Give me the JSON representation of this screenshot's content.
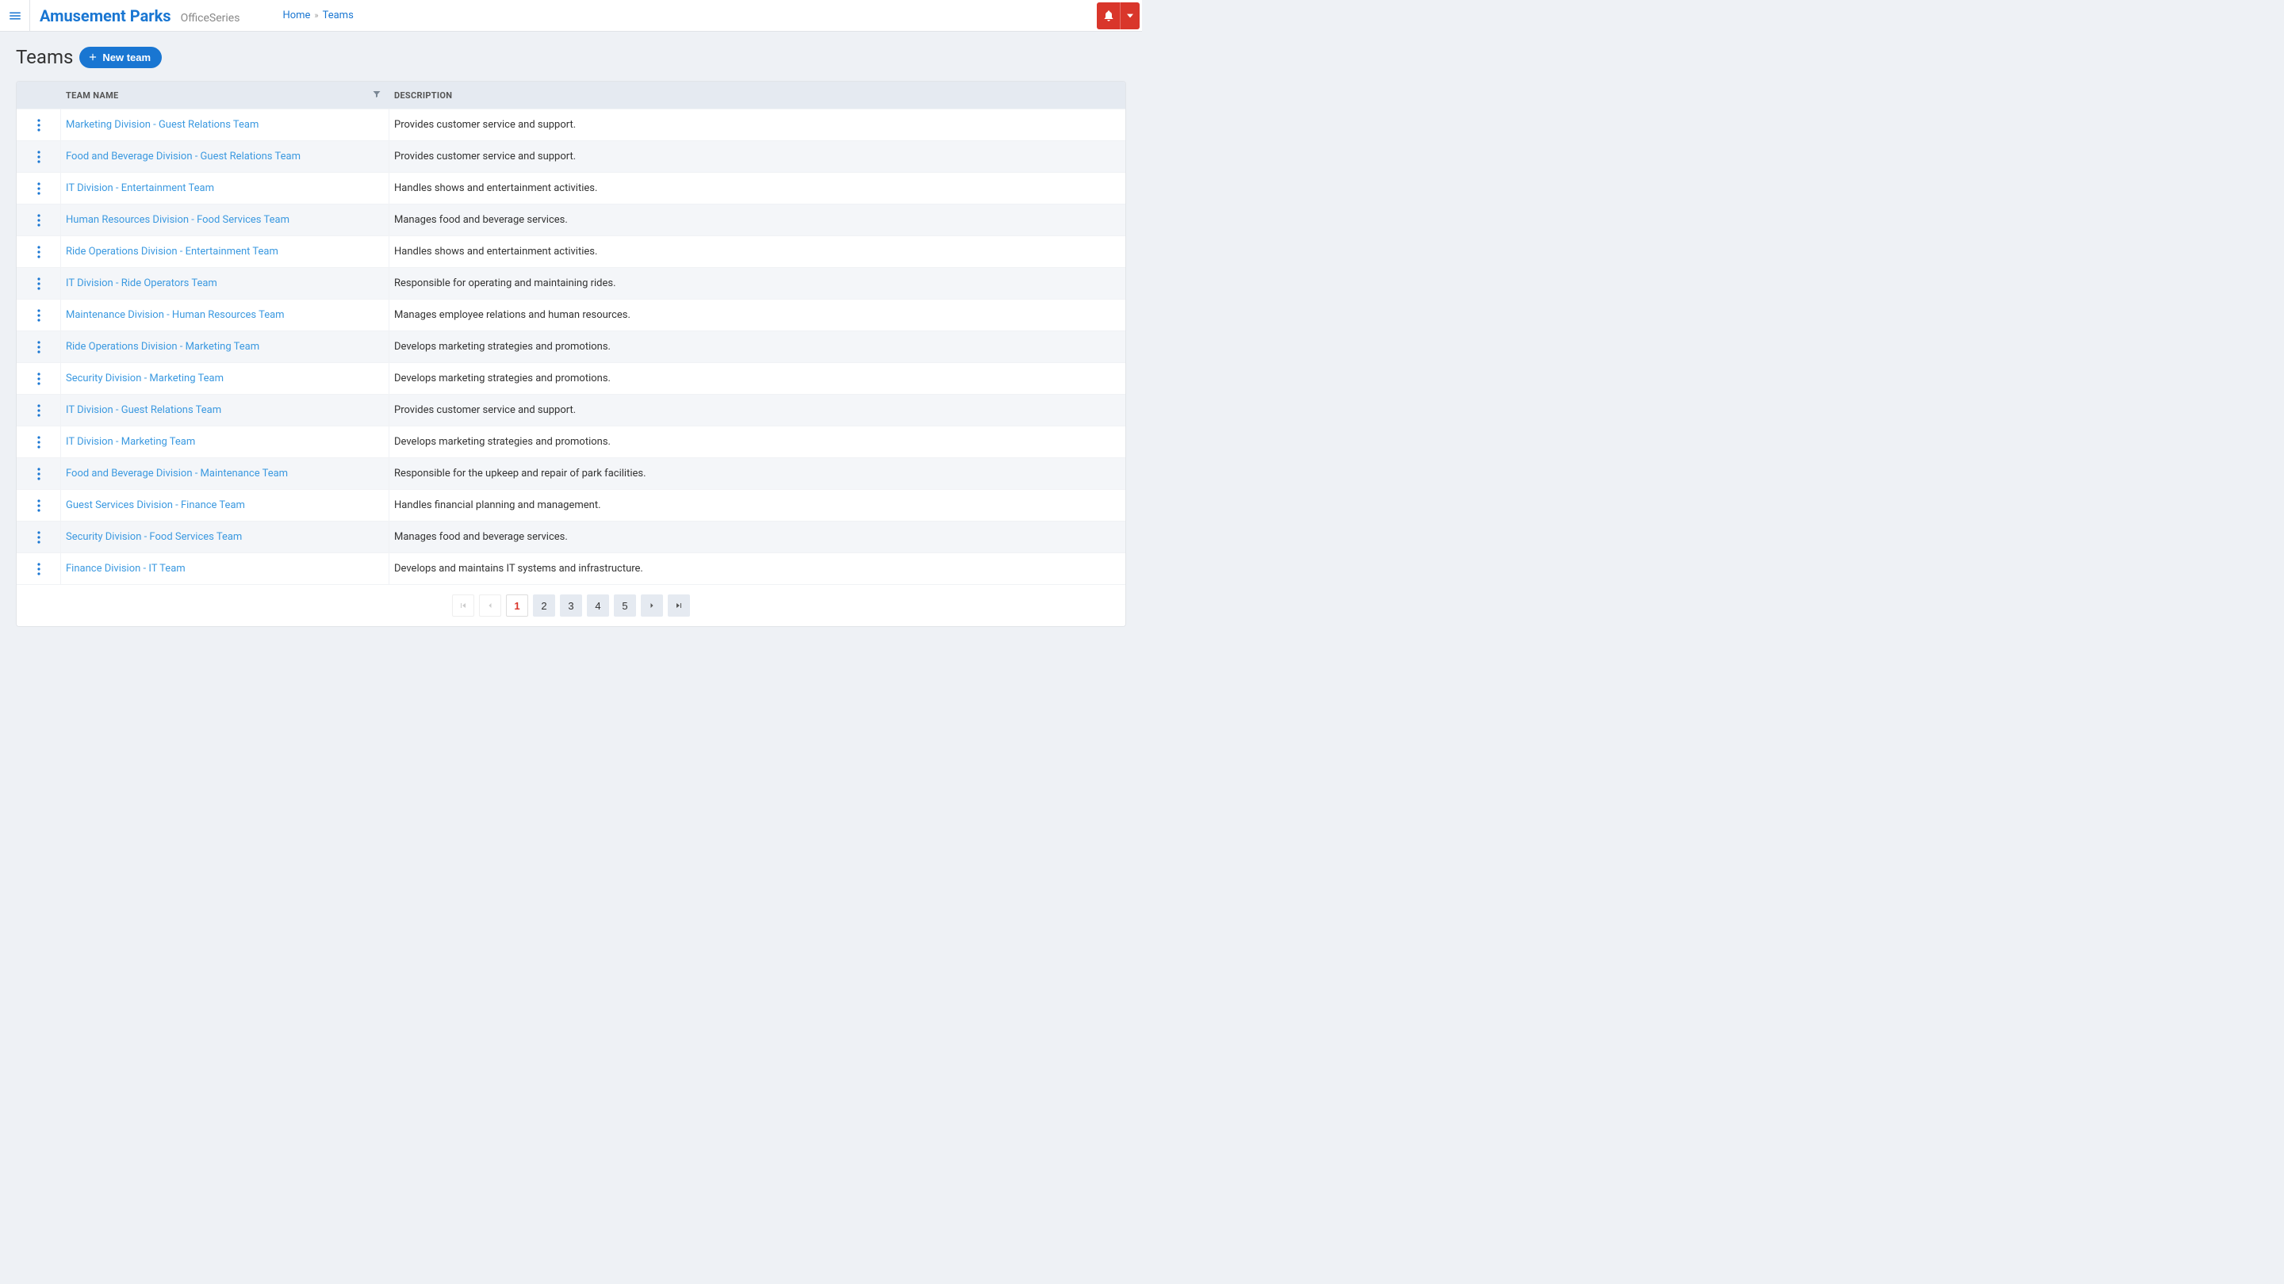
{
  "brand": {
    "name": "Amusement Parks",
    "sub": "OfficeSeries"
  },
  "breadcrumbs": {
    "home": "Home",
    "current": "Teams"
  },
  "page": {
    "title": "Teams",
    "newButton": "New team"
  },
  "table": {
    "headers": {
      "name": "TEAM NAME",
      "description": "DESCRIPTION"
    },
    "rows": [
      {
        "name": "Marketing Division - Guest Relations Team",
        "description": "Provides customer service and support."
      },
      {
        "name": "Food and Beverage Division - Guest Relations Team",
        "description": "Provides customer service and support."
      },
      {
        "name": "IT Division - Entertainment Team",
        "description": "Handles shows and entertainment activities."
      },
      {
        "name": "Human Resources Division - Food Services Team",
        "description": "Manages food and beverage services."
      },
      {
        "name": "Ride Operations Division - Entertainment Team",
        "description": "Handles shows and entertainment activities."
      },
      {
        "name": "IT Division - Ride Operators Team",
        "description": "Responsible for operating and maintaining rides."
      },
      {
        "name": "Maintenance Division - Human Resources Team",
        "description": "Manages employee relations and human resources."
      },
      {
        "name": "Ride Operations Division - Marketing Team",
        "description": "Develops marketing strategies and promotions."
      },
      {
        "name": "Security Division - Marketing Team",
        "description": "Develops marketing strategies and promotions."
      },
      {
        "name": "IT Division - Guest Relations Team",
        "description": "Provides customer service and support."
      },
      {
        "name": "IT Division - Marketing Team",
        "description": "Develops marketing strategies and promotions."
      },
      {
        "name": "Food and Beverage Division - Maintenance Team",
        "description": "Responsible for the upkeep and repair of park facilities."
      },
      {
        "name": "Guest Services Division - Finance Team",
        "description": "Handles financial planning and management."
      },
      {
        "name": "Security Division - Food Services Team",
        "description": "Manages food and beverage services."
      },
      {
        "name": "Finance Division - IT Team",
        "description": "Develops and maintains IT systems and infrastructure."
      }
    ]
  },
  "pagination": {
    "pages": [
      "1",
      "2",
      "3",
      "4",
      "5"
    ],
    "current": 1
  }
}
